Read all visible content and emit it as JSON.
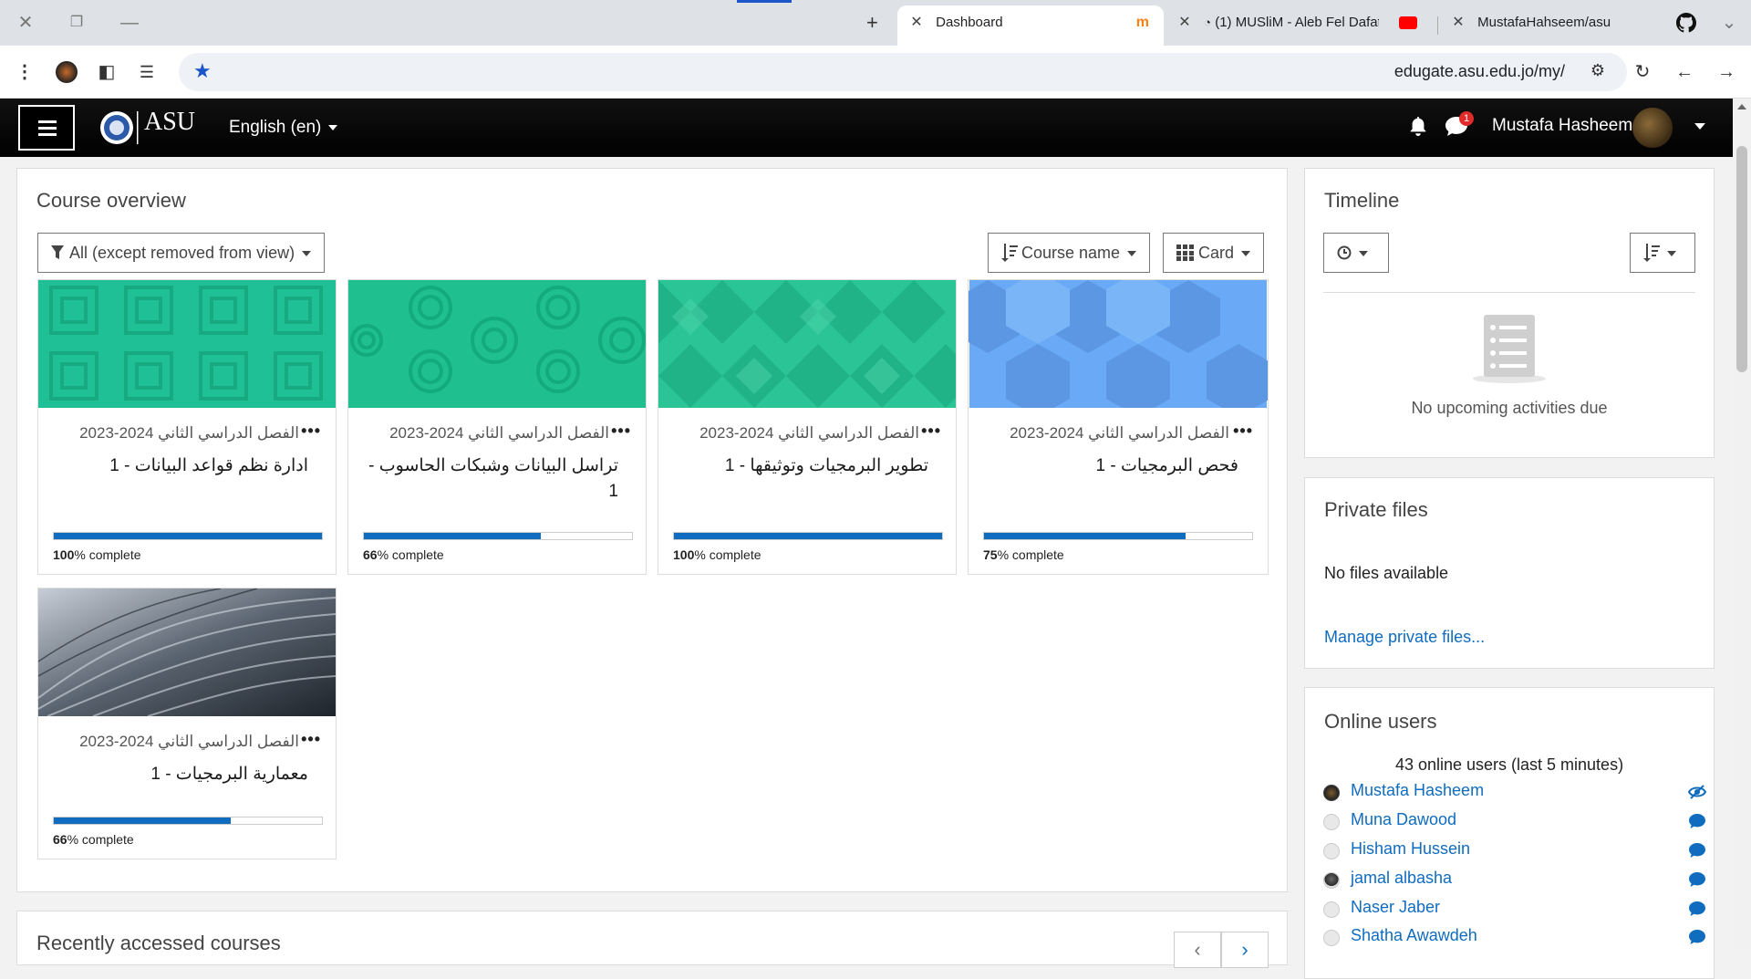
{
  "browser": {
    "tabs": [
      {
        "title": "Dashboard",
        "active": true
      },
      {
        "title": "(1) MUSliM - Aleb Fel Dafat",
        "active": false
      },
      {
        "title": "MustafaHahseem/asu",
        "active": false
      }
    ],
    "new_tab_label": "+",
    "url": "edugate.asu.edu.jo/my/"
  },
  "navbar": {
    "language": "English (en)",
    "notification_count": "1",
    "user_name": "Mustafa Hasheem",
    "logo_text": "ASU"
  },
  "course_overview": {
    "title": "Course overview",
    "filter_label": "All (except removed from view)",
    "sort_label": "Course name",
    "view_label": "Card",
    "courses": [
      {
        "category": "الفصل الدراسي الثاني 2024-2023",
        "name": "ادارة نظم قواعد البيانات - 1",
        "progress": 100,
        "progress_label": "100",
        "complete_text": "% complete",
        "pattern": "squares",
        "color": "#1fc095"
      },
      {
        "category": "الفصل الدراسي الثاني 2024-2023",
        "name": "تراسل البيانات وشبكات الحاسوب - 1",
        "progress": 66,
        "progress_label": "66",
        "complete_text": "% complete",
        "pattern": "circles",
        "color": "#1fbf8f"
      },
      {
        "category": "الفصل الدراسي الثاني 2024-2023",
        "name": "تطوير البرمجيات وتوثيقها - 1",
        "progress": 100,
        "progress_label": "100",
        "complete_text": "% complete",
        "pattern": "diamonds",
        "color": "#2bc496"
      },
      {
        "category": "الفصل الدراسي الثاني 2024-2023",
        "name": "فحص البرمجيات - 1",
        "progress": 75,
        "progress_label": "75",
        "complete_text": "% complete",
        "pattern": "hexagons",
        "color": "#69a9f5"
      },
      {
        "category": "الفصل الدراسي الثاني 2024-2023",
        "name": "معمارية البرمجيات - 1",
        "progress": 66,
        "progress_label": "66",
        "complete_text": "% complete",
        "pattern": "photo",
        "color": "#3a4450"
      }
    ]
  },
  "recently_accessed": {
    "title": "Recently accessed courses"
  },
  "timeline": {
    "title": "Timeline",
    "empty_text": "No upcoming activities due"
  },
  "private_files": {
    "title": "Private files",
    "empty_text": "No files available",
    "manage_link": "Manage private files..."
  },
  "online_users": {
    "title": "Online users",
    "summary": "43 online users (last 5 minutes)",
    "users": [
      {
        "name": "Mustafa Hasheem",
        "avatar": "photo-dark",
        "action": "eye"
      },
      {
        "name": "Muna Dawood",
        "avatar": "default",
        "action": "message"
      },
      {
        "name": "Hisham Hussein",
        "avatar": "default",
        "action": "message"
      },
      {
        "name": "jamal albasha",
        "avatar": "photo",
        "action": "message"
      },
      {
        "name": "Naser Jaber",
        "avatar": "default",
        "action": "message"
      },
      {
        "name": "Shatha Awawdeh",
        "avatar": "default",
        "action": "message"
      }
    ]
  }
}
